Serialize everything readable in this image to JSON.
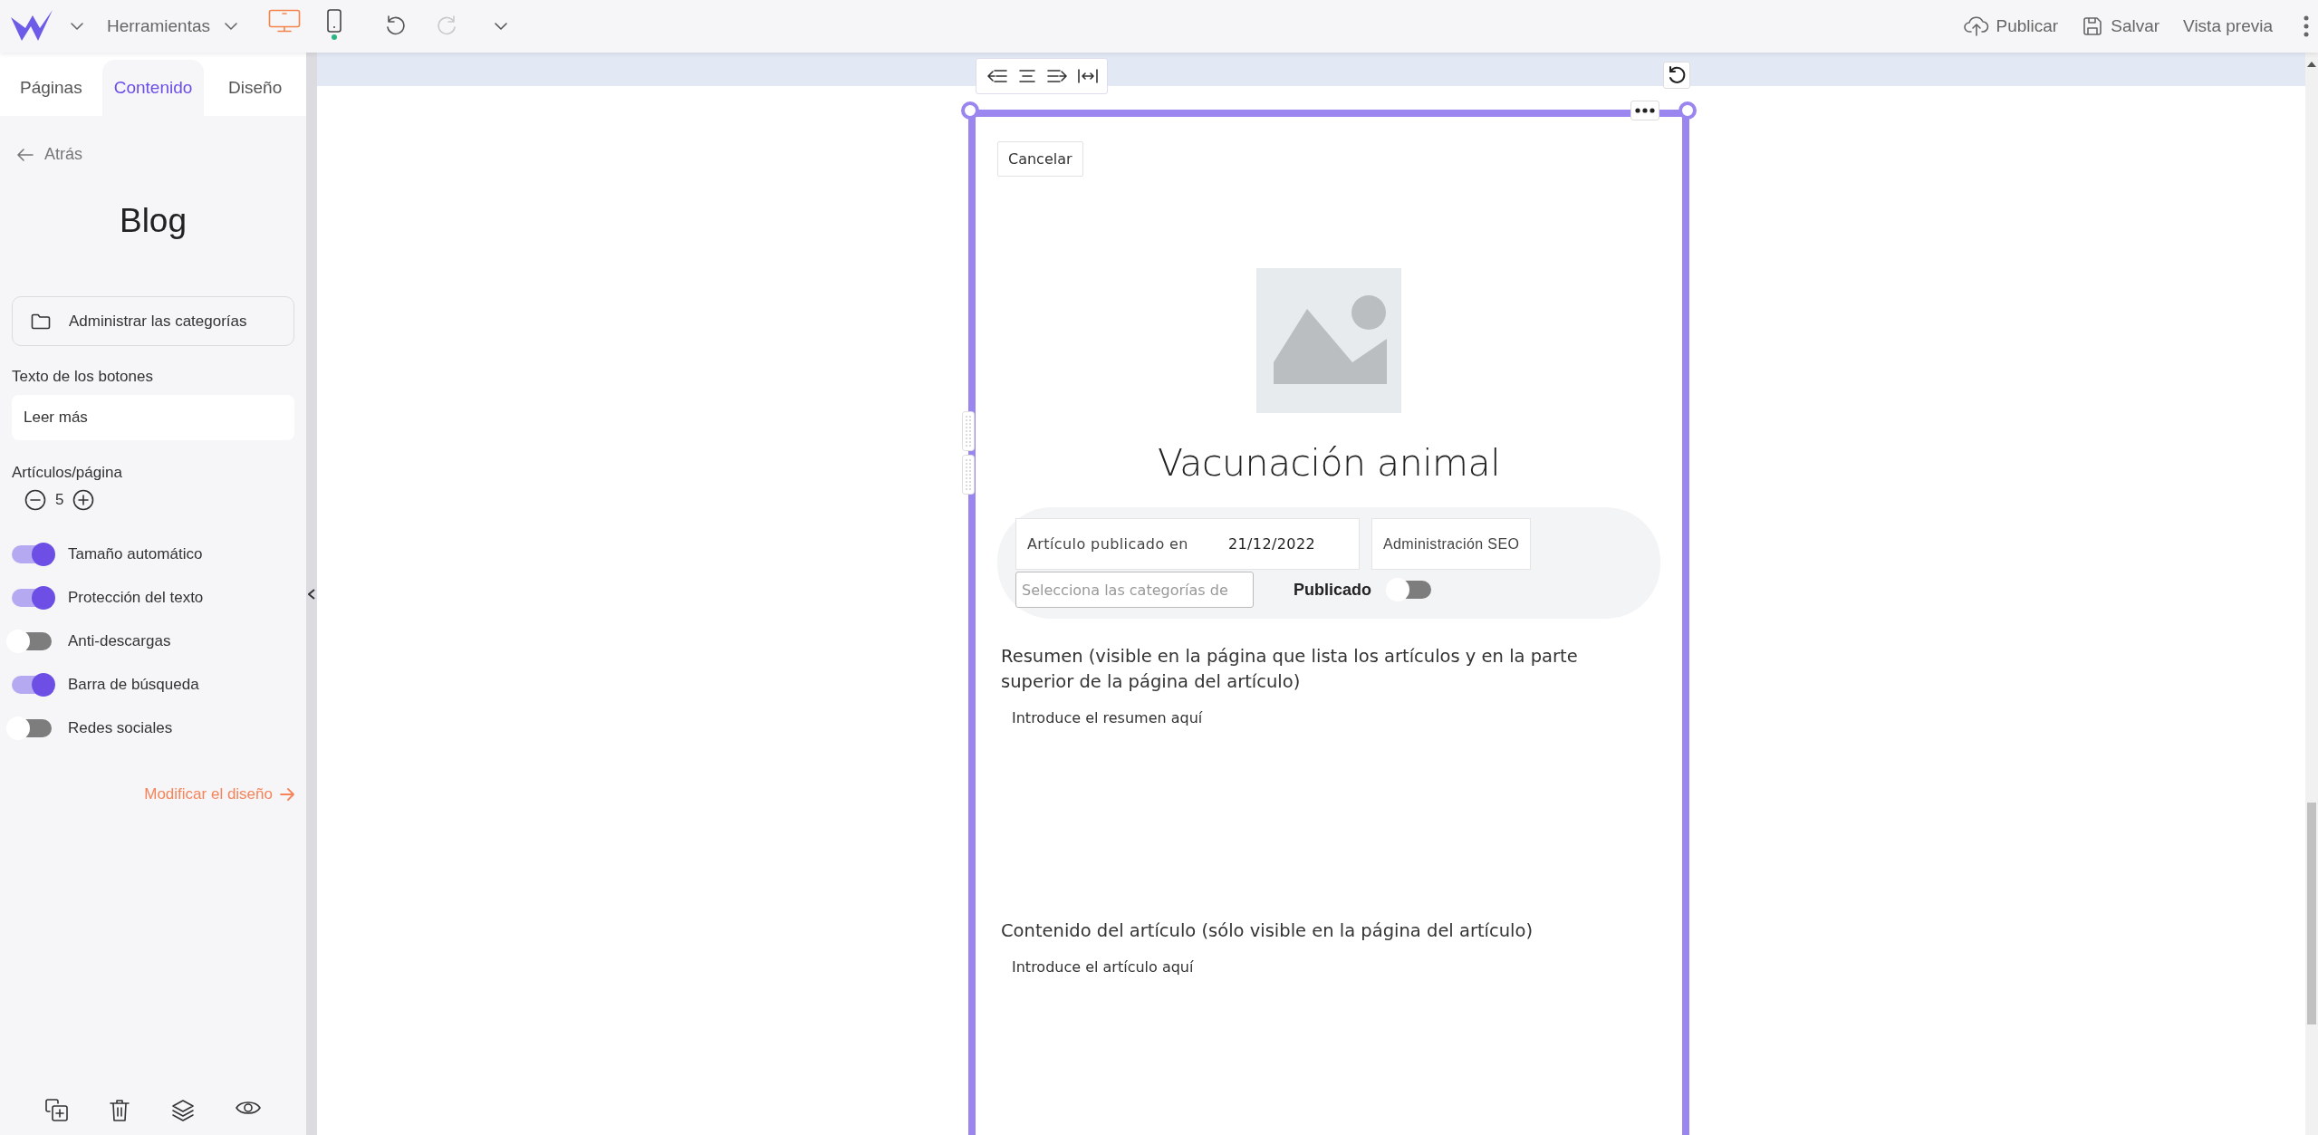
{
  "topbar": {
    "tools_menu": "Herramientas",
    "devices": [
      {
        "kind": "desktop",
        "selected": true
      },
      {
        "kind": "mobile",
        "selected": false
      }
    ],
    "history": [
      {
        "kind": "undo",
        "disabled": false
      },
      {
        "kind": "redo",
        "disabled": true
      }
    ],
    "actions": [
      {
        "kind": "publish",
        "label": "Publicar"
      },
      {
        "kind": "save",
        "label": "Salvar"
      },
      {
        "kind": "preview",
        "label": "Vista previa"
      }
    ]
  },
  "sidebar": {
    "tabs": [
      {
        "label": "Páginas",
        "selected": false
      },
      {
        "label": "Contenido",
        "selected": true
      },
      {
        "label": "Diseño",
        "selected": false
      }
    ],
    "back": "Atrás",
    "title": "Blog",
    "manage_button": "Administrar las categorías",
    "button_text": {
      "label": "Texto de los botones",
      "value": "Leer más"
    },
    "per_page": {
      "label": "Artículos/página",
      "value": "5"
    },
    "toggles": [
      {
        "label": "Tamaño automático",
        "on": true
      },
      {
        "label": "Protección del texto",
        "on": true
      },
      {
        "label": "Anti-descargas",
        "on": false
      },
      {
        "label": "Barra de búsqueda",
        "on": true
      },
      {
        "label": "Redes sociales",
        "on": false
      }
    ],
    "design_link": "Modificar el diseño"
  },
  "editor": {
    "cancel": "Cancelar",
    "title": "Vacunación animal",
    "published_label": "Artículo publicado en",
    "date": "21/12/2022",
    "seo_button": "Administración SEO",
    "category_field": {
      "placeholder": "Selecciona las categorías de"
    },
    "published_toggle": {
      "label": "Publicado",
      "on": false
    },
    "summary": {
      "label": "Resumen (visible en la página que lista los artículos y en la parte superior de la página del artículo)",
      "placeholder": "Introduce el resumen aquí"
    },
    "content": {
      "label": "Contenido del artículo (sólo visible en la página del artículo)",
      "placeholder": "Introduce el artículo aquí"
    }
  }
}
